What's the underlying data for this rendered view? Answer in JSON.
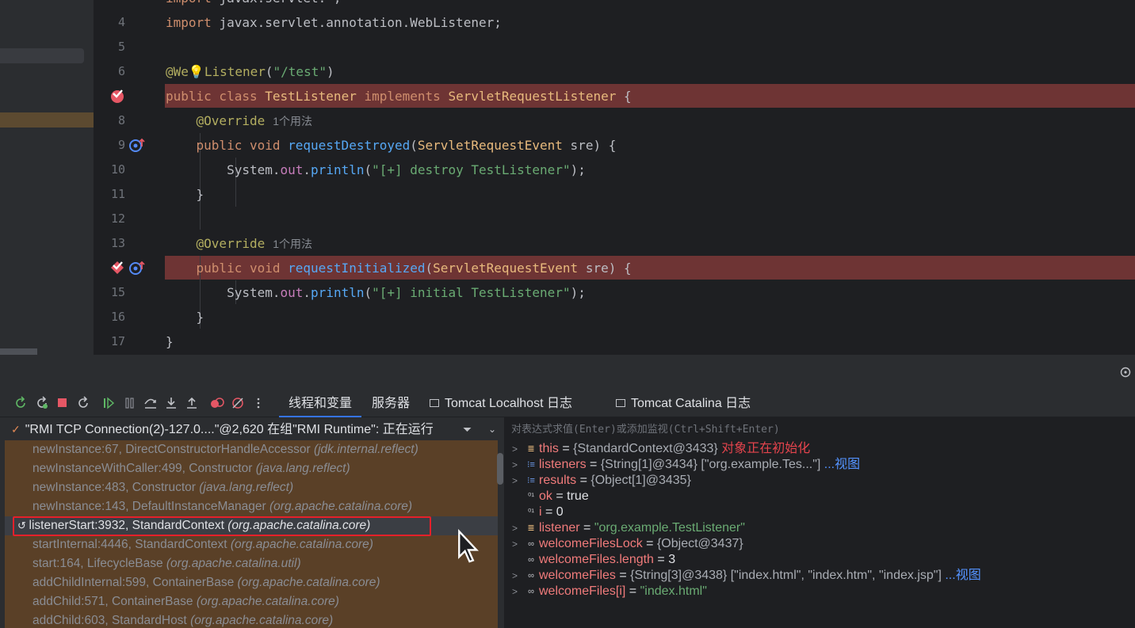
{
  "editor": {
    "top_partial_line": "import javax.servlet.*;",
    "lines": [
      {
        "num": "4",
        "tokens": [
          [
            "kw",
            "import "
          ],
          [
            "",
            "javax.servlet.annotation.WebListener;"
          ]
        ]
      },
      {
        "num": "5",
        "tokens": []
      },
      {
        "num": "6",
        "tokens": [
          [
            "ann",
            "@We"
          ],
          [
            "ann",
            "💡"
          ],
          [
            "ann",
            "Listener"
          ],
          [
            "",
            "("
          ],
          [
            "str",
            "\"/test\""
          ],
          [
            "",
            ")"
          ]
        ]
      },
      {
        "num": "",
        "tokens": [
          [
            "kw",
            "public class "
          ],
          [
            "cls",
            "TestListener "
          ],
          [
            "kw",
            "implements "
          ],
          [
            "cls",
            "ServletRequestListener "
          ],
          [
            "",
            "{"
          ]
        ]
      },
      {
        "num": "8",
        "tokens": [
          [
            "ann",
            "    @Override"
          ],
          [
            "usage",
            "1个用法"
          ]
        ]
      },
      {
        "num": "9",
        "tokens": [
          [
            "kw",
            "    public void "
          ],
          [
            "fn",
            "requestDestroyed"
          ],
          [
            "",
            "("
          ],
          [
            "cls",
            "ServletRequestEvent "
          ],
          [
            "",
            "sre) {"
          ]
        ]
      },
      {
        "num": "10",
        "tokens": [
          [
            "",
            "        System."
          ],
          [
            "fld",
            "out"
          ],
          [
            "",
            "."
          ],
          [
            "fn",
            "println"
          ],
          [
            "",
            "("
          ],
          [
            "str",
            "\"[+] destroy TestListener\""
          ],
          [
            "",
            ");"
          ]
        ]
      },
      {
        "num": "11",
        "tokens": [
          [
            "",
            "    }"
          ]
        ]
      },
      {
        "num": "12",
        "tokens": []
      },
      {
        "num": "13",
        "tokens": [
          [
            "ann",
            "    @Override"
          ],
          [
            "usage",
            "1个用法"
          ]
        ]
      },
      {
        "num": "",
        "tokens": [
          [
            "kw",
            "    public void "
          ],
          [
            "fn",
            "requestInitialized"
          ],
          [
            "",
            "("
          ],
          [
            "cls",
            "ServletRequestEvent "
          ],
          [
            "",
            "sre) {"
          ]
        ]
      },
      {
        "num": "15",
        "tokens": [
          [
            "",
            "        System."
          ],
          [
            "fld",
            "out"
          ],
          [
            "",
            "."
          ],
          [
            "fn",
            "println"
          ],
          [
            "",
            "("
          ],
          [
            "str",
            "\"[+] initial TestListener\""
          ],
          [
            "",
            ");"
          ]
        ]
      },
      {
        "num": "16",
        "tokens": [
          [
            "",
            "    }"
          ]
        ]
      },
      {
        "num": "17",
        "tokens": [
          [
            "",
            "}"
          ]
        ]
      }
    ]
  },
  "debugger": {
    "tabs": [
      {
        "label": "线程和变量",
        "active": true
      },
      {
        "label": "服务器",
        "active": false
      },
      {
        "label": "Tomcat Localhost 日志",
        "active": false
      },
      {
        "label": "Tomcat Catalina 日志",
        "active": false
      }
    ],
    "thread": "\"RMI TCP Connection(2)-127.0....\"@2,620 在组\"RMI Runtime\": 正在运行",
    "frames": [
      {
        "method": "newInstance:67, DirectConstructorHandleAccessor",
        "pkg": "(jdk.internal.reflect)"
      },
      {
        "method": "newInstanceWithCaller:499, Constructor",
        "pkg": "(java.lang.reflect)"
      },
      {
        "method": "newInstance:483, Constructor",
        "pkg": "(java.lang.reflect)"
      },
      {
        "method": "newInstance:143, DefaultInstanceManager",
        "pkg": "(org.apache.catalina.core)"
      },
      {
        "method": "listenerStart:3932, StandardContext",
        "pkg": "(org.apache.catalina.core)",
        "selected": true
      },
      {
        "method": "startInternal:4446, StandardContext",
        "pkg": "(org.apache.catalina.core)"
      },
      {
        "method": "start:164, LifecycleBase",
        "pkg": "(org.apache.catalina.util)"
      },
      {
        "method": "addChildInternal:599, ContainerBase",
        "pkg": "(org.apache.catalina.core)"
      },
      {
        "method": "addChild:571, ContainerBase",
        "pkg": "(org.apache.catalina.core)"
      },
      {
        "method": "addChild:603, StandardHost",
        "pkg": "(org.apache.catalina.core)"
      }
    ],
    "eval_placeholder": "对表达式求值(Enter)或添加监视(Ctrl+Shift+Enter)",
    "variables": [
      {
        "arrow": ">",
        "icon": "field",
        "name": "this",
        "value": "{StandardContext@3433}",
        "note": "对象正在初始化"
      },
      {
        "arrow": ">",
        "icon": "array",
        "name": "listeners",
        "value": "{String[1]@3434} [\"org.example.Tes...\"]",
        "link": "...视图"
      },
      {
        "arrow": ">",
        "icon": "array",
        "name": "results",
        "value": "{Object[1]@3435}"
      },
      {
        "arrow": "",
        "icon": "bool",
        "name": "ok",
        "value": "true"
      },
      {
        "arrow": "",
        "icon": "bool",
        "name": "i",
        "value": "0"
      },
      {
        "arrow": ">",
        "icon": "field",
        "name": "listener",
        "value": "\"org.example.TestListener\"",
        "str": true
      },
      {
        "arrow": ">",
        "icon": "watch",
        "name": "welcomeFilesLock",
        "value": "{Object@3437}"
      },
      {
        "arrow": "",
        "icon": "watch",
        "name": "welcomeFiles.length",
        "value": "3"
      },
      {
        "arrow": ">",
        "icon": "watch",
        "name": "welcomeFiles",
        "value": "{String[3]@3438} [\"index.html\", \"index.htm\", \"index.jsp\"]",
        "link": "...视图"
      },
      {
        "arrow": ">",
        "icon": "watch",
        "name": "welcomeFiles[i]",
        "value": "\"index.html\"",
        "str": true
      }
    ]
  },
  "colors": {
    "breakpoint_line": "#6e3434",
    "frames_bg": "#5a4027",
    "selection_box": "#e5202a",
    "accent": "#3574f0"
  }
}
